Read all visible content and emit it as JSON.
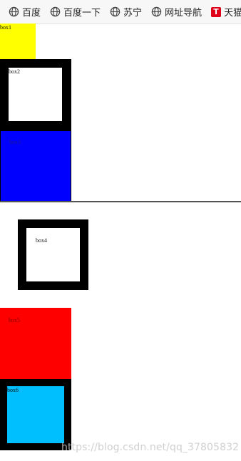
{
  "bookmarks": [
    {
      "label": "百度",
      "icon": "globe-icon"
    },
    {
      "label": "百度一下",
      "icon": "globe-icon"
    },
    {
      "label": "苏宁",
      "icon": "globe-icon"
    },
    {
      "label": "网址导航",
      "icon": "globe-icon"
    },
    {
      "label": "天猫双",
      "icon": "tmall-icon",
      "icon_text": "T"
    }
  ],
  "boxes": {
    "box1": {
      "label": "box1",
      "color": "#ffff00"
    },
    "box2": {
      "label": "box2",
      "border_color": "#000000",
      "fill": "#ffffff"
    },
    "box3": {
      "label": "box3",
      "color": "#0000ff"
    },
    "box4": {
      "label": "box4",
      "border_color": "#000000",
      "fill": "#ffffff"
    },
    "box5": {
      "label": "box5",
      "color": "#ff0000"
    },
    "box6": {
      "label": "box6",
      "border_color": "#000000",
      "fill": "#00bfff"
    }
  },
  "watermark": "https://blog.csdn.net/qq_37805832"
}
